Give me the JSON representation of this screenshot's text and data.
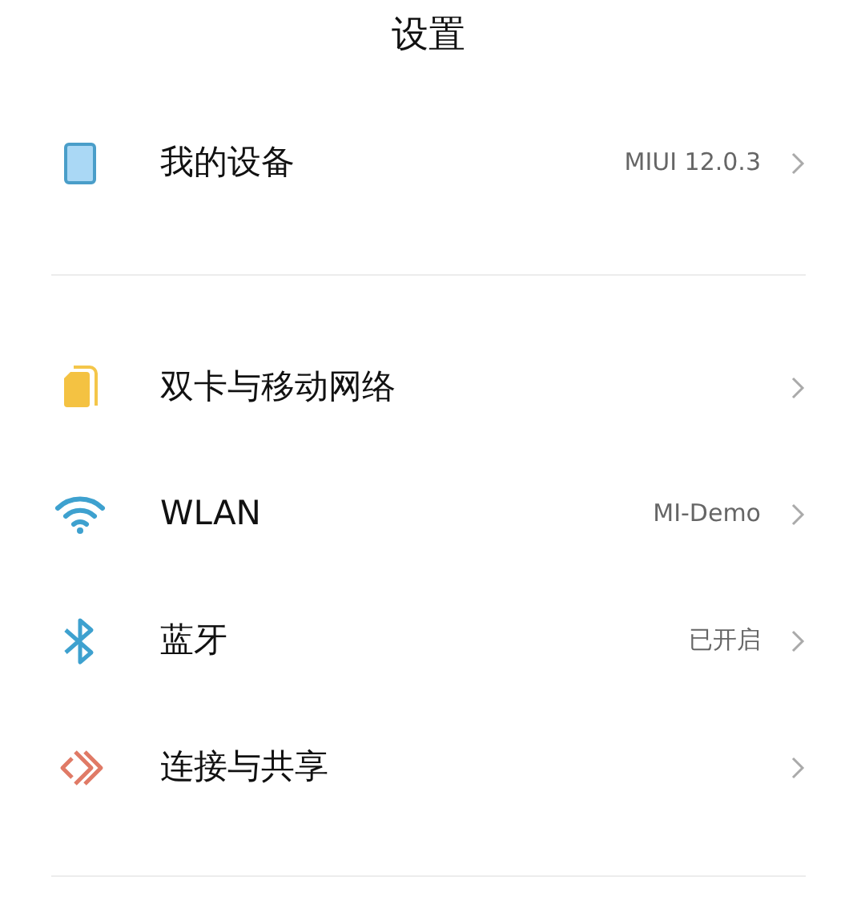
{
  "title": "设置",
  "sections": [
    {
      "items": [
        {
          "kind": "device",
          "label": "我的设备",
          "value": "MIUI 12.0.3"
        }
      ]
    },
    {
      "items": [
        {
          "kind": "sim",
          "label": "双卡与移动网络"
        },
        {
          "kind": "wifi",
          "label": "WLAN",
          "value": "MI-Demo"
        },
        {
          "kind": "bluetooth",
          "label": "蓝牙",
          "value": "已开启"
        },
        {
          "kind": "share",
          "label": "连接与共享"
        }
      ]
    }
  ]
}
